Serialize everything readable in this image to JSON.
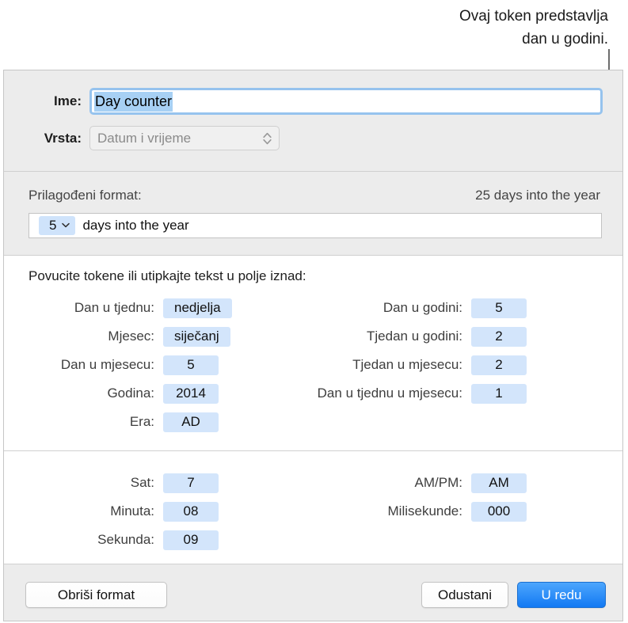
{
  "callout": {
    "caption": "Ovaj token predstavlja\ndan u godini.",
    "line_color": "#6d6d6d"
  },
  "dialog": {
    "name_field": {
      "label": "Ime:",
      "value": "Day counter",
      "placeholder": "",
      "selection_color": "#a7d0f4",
      "focus_ring_color": "#96c3ee"
    },
    "type_field": {
      "label": "Vrsta:",
      "value": "Datum i vrijeme",
      "stepper_icon": "chevron-up-down-icon",
      "enabled": false
    },
    "custom_format": {
      "label": "Prilagođeni format:",
      "preview": "25 days into the year",
      "token": {
        "value": "5",
        "chevron_icon": "chevron-down-icon"
      },
      "text": "days into the year"
    },
    "tokens_section": {
      "hint": "Povucite tokene ili utipkajte tekst u polje iznad:",
      "date_left": [
        {
          "label": "Dan u tjednu:",
          "value": "nedjelja"
        },
        {
          "label": "Mjesec:",
          "value": "siječanj"
        },
        {
          "label": "Dan u mjesecu:",
          "value": "5"
        },
        {
          "label": "Godina:",
          "value": "2014"
        },
        {
          "label": "Era:",
          "value": "AD"
        }
      ],
      "date_right": [
        {
          "label": "Dan u godini:",
          "value": "5"
        },
        {
          "label": "Tjedan u godini:",
          "value": "2"
        },
        {
          "label": "Tjedan u mjesecu:",
          "value": "2"
        },
        {
          "label": "Dan u tjednu u mjesecu:",
          "value": "1"
        }
      ],
      "time_left": [
        {
          "label": "Sat:",
          "value": "7"
        },
        {
          "label": "Minuta:",
          "value": "08"
        },
        {
          "label": "Sekunda:",
          "value": "09"
        }
      ],
      "time_right": [
        {
          "label": "AM/PM:",
          "value": "AM"
        },
        {
          "label": "Milisekunde:",
          "value": "000"
        }
      ],
      "token_color": "#d3e5fb"
    },
    "footer": {
      "clear_label": "Obriši format",
      "cancel_label": "Odustani",
      "ok_label": "U redu",
      "ok_accent_color": "#1279f3"
    }
  }
}
